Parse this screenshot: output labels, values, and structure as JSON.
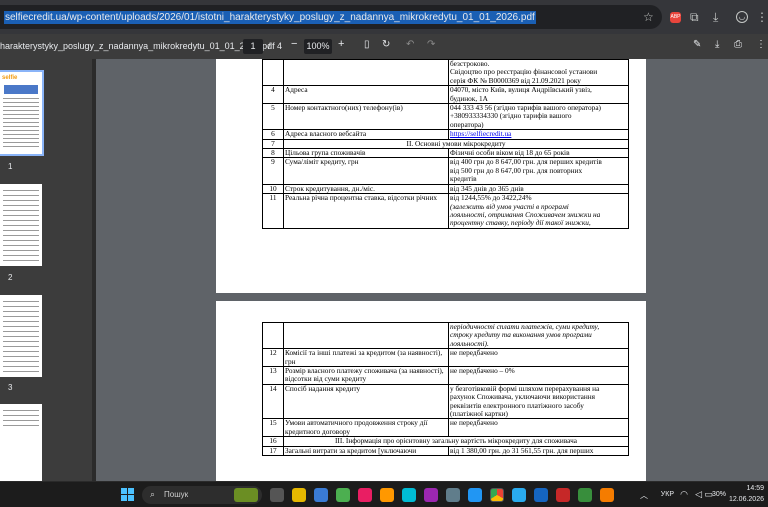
{
  "browser": {
    "url": "selfiecredit.ua/wp-content/uploads/2026/01/istotni_harakterystyky_poslugy_z_nadannya_mikrokredytu_01_01_2026.pdf",
    "extension_badge": "ABP"
  },
  "pdf_toolbar": {
    "filename": "harakterystyky_poslugy_z_nadannya_mikrokredytu_01_01_2026.pdf",
    "page_current": "1",
    "page_sep": "/",
    "page_total": "4",
    "zoom": "100%"
  },
  "thumbnails": [
    {
      "number": "1",
      "logo": "selfie"
    },
    {
      "number": "2"
    },
    {
      "number": "3"
    },
    {
      "number": ""
    }
  ],
  "page1": {
    "rows": [
      {
        "n": "",
        "k": "",
        "v": [
          "безстроково.",
          "Свідоцтво про реєстрацію фінансової установи",
          "серія ФК № В0000369 від 21.09.2021 року"
        ]
      },
      {
        "n": "4",
        "k": "Адреса",
        "v": [
          "04070, місто Київ, вулиця Андріївський узвіз,",
          "будинок, 1А"
        ]
      },
      {
        "n": "5",
        "k": "Номер контактного(них) телефону(ів)",
        "v": [
          "044 333 43 56 (згідно тарифів вашого оператора)",
          "+380933334330 (згідно тарифів вашого",
          "оператора)"
        ]
      },
      {
        "n": "6",
        "k": "Адреса власного вебсайта",
        "link": "https://selfiecredit.ua"
      },
      {
        "n": "7",
        "section": "ІІ. Основні умови мікрокредиту"
      },
      {
        "n": "8",
        "k": "Цільова група споживачів",
        "v": [
          "Фізичні особи віком від 18 до 65 років"
        ]
      },
      {
        "n": "9",
        "k": "Сума/ліміт кредиту, грн",
        "v": [
          "від 400 грн до 8 647,00 грн. для перших кредитів",
          "від 500 грн до 8 647,00 грн. для повторних",
          "кредитів"
        ]
      },
      {
        "n": "10",
        "k": "Строк кредитування, дн./міс.",
        "v": [
          "від 345 днів до 365 днів"
        ]
      },
      {
        "n": "11",
        "k": "Реальна річна процентна ставка, відсотки річних",
        "v": [
          "від 1244,55% до 3422,24%"
        ],
        "note": [
          "(залежить від умов участі в програмі",
          "лояльності, отримання Споживачем знижки на",
          "процентну ставку, періоду дії такої знижки,"
        ]
      }
    ]
  },
  "page2": {
    "rows": [
      {
        "n": "",
        "k": "",
        "note": [
          "періодичності сплати платежів, суми кредиту,",
          "строку кредиту та виконання умов програми",
          "лояльності)."
        ]
      },
      {
        "n": "12",
        "k": "Комісії та інші платежі за кредитом (за наявності), грн",
        "v": [
          "не передбачено"
        ]
      },
      {
        "n": "13",
        "k": "Розмір власного платежу споживача (за наявності), відсотки від суми кредиту",
        "v": [
          "не передбачено – 0%"
        ]
      },
      {
        "n": "14",
        "k": "Спосіб надання кредиту",
        "v": [
          "у безготівковій формі шляхом перерахування на",
          "рахунок Споживача, уключаючи використання",
          "реквізитів електронного платіжного засобу",
          "(платіжної картки)"
        ]
      },
      {
        "n": "15",
        "k": "Умови автоматичного продовження строку дії кредитного договору",
        "v": [
          "не передбачено"
        ]
      },
      {
        "n": "16",
        "section": "ІІІ. Інформація про орієнтовну загальну вартість мікрокредиту для споживача"
      },
      {
        "n": "17",
        "k": "Загальні витрати за кредитом [уключаючи",
        "v": [
          "від 1 380,00 грн. до 31 561,55 грн. для перших"
        ]
      }
    ]
  },
  "taskbar": {
    "search_placeholder": "Пошук",
    "language": "УКР",
    "battery": "30%",
    "time": "14:59",
    "date": "12.06.2026"
  },
  "colors": {
    "accent": "#1a5fb4",
    "chrome_bg": "#35363a",
    "viewer_bg": "#5f6368"
  }
}
